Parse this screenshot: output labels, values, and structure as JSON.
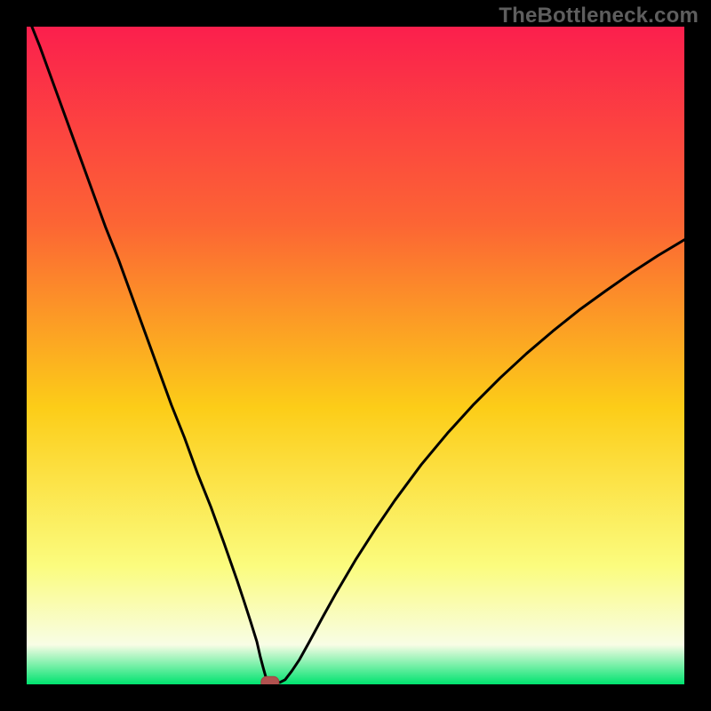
{
  "watermark": {
    "text": "TheBottleneck.com"
  },
  "colors": {
    "page_bg": "#000000",
    "gradient_top": "#fb1f4d",
    "gradient_upper": "#fc6534",
    "gradient_mid": "#fccd18",
    "gradient_lower": "#fbfc7e",
    "gradient_pale": "#f8fde5",
    "gradient_bottom": "#00e36f",
    "curve": "#000000",
    "marker_fill": "#b1514f",
    "marker_stroke": "#a04542"
  },
  "chart_data": {
    "type": "line",
    "title": "",
    "xlabel": "",
    "ylabel": "",
    "xlim": [
      0,
      100
    ],
    "ylim": [
      0,
      100
    ],
    "x": [
      0,
      2,
      4,
      6,
      8,
      10,
      12,
      14,
      16,
      18,
      20,
      22,
      24,
      26,
      28,
      30,
      32,
      33,
      34,
      35,
      35.5,
      36,
      36.6,
      37.2,
      37.8,
      38.5,
      39.3,
      40.3,
      41.5,
      43,
      45,
      47,
      50,
      53,
      56,
      60,
      64,
      68,
      72,
      76,
      80,
      84,
      88,
      92,
      96,
      100
    ],
    "values": [
      102,
      97,
      91.5,
      86,
      80.5,
      75,
      69.5,
      64.5,
      59,
      53.5,
      48,
      42.5,
      37.5,
      32,
      27,
      21.5,
      15.8,
      12.8,
      9.7,
      6.5,
      4.3,
      2.4,
      0.3,
      0.3,
      0.3,
      0.3,
      0.7,
      2.0,
      3.8,
      6.5,
      10.2,
      13.8,
      18.9,
      23.6,
      28.0,
      33.4,
      38.2,
      42.6,
      46.6,
      50.3,
      53.7,
      56.9,
      59.8,
      62.6,
      65.2,
      67.6
    ],
    "marker": {
      "x": 37.0,
      "y": 0.3
    }
  }
}
